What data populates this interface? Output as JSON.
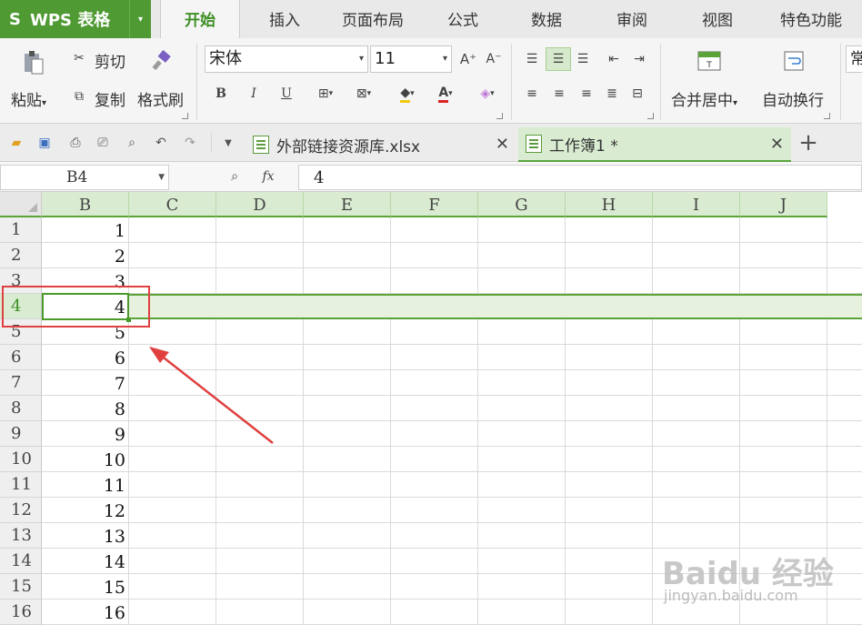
{
  "app": {
    "logo": "S",
    "name": "WPS 表格"
  },
  "menu": {
    "tabs": [
      {
        "label": "开始",
        "active": true
      },
      {
        "label": "插入"
      },
      {
        "label": "页面布局"
      },
      {
        "label": "公式"
      },
      {
        "label": "数据"
      },
      {
        "label": "审阅"
      },
      {
        "label": "视图"
      },
      {
        "label": "特色功能"
      }
    ]
  },
  "ribbon": {
    "paste": "粘贴",
    "cut": "剪切",
    "copy": "复制",
    "format_painter": "格式刷",
    "font_name": "宋体",
    "font_size": "11",
    "bold": "B",
    "italic": "I",
    "underline": "U",
    "grow_font": "A⁺",
    "shrink_font": "A⁻",
    "merge_center": "合并居中",
    "wrap_text": "自动换行",
    "number_format": "常"
  },
  "tabs": {
    "doc1": "外部链接资源库.xlsx",
    "doc2": "工作簿1 *",
    "add": "+"
  },
  "formula_bar": {
    "name_box": "B4",
    "fx": "fx",
    "value": "4"
  },
  "grid": {
    "columns": [
      "B",
      "C",
      "D",
      "E",
      "F",
      "G",
      "H",
      "I",
      "J"
    ],
    "rows": [
      "1",
      "2",
      "3",
      "4",
      "5",
      "6",
      "7",
      "8",
      "9",
      "10",
      "11",
      "12",
      "13",
      "14",
      "15",
      "16"
    ],
    "column_b_values": [
      "1",
      "2",
      "3",
      "4",
      "5",
      "6",
      "7",
      "8",
      "9",
      "10",
      "11",
      "12",
      "13",
      "14",
      "15",
      "16"
    ],
    "selected_cell": "B4"
  },
  "watermark": {
    "line1": "Baidu 经验",
    "line2": "jingyan.baidu.com"
  },
  "colors": {
    "accent": "#4f9a32",
    "selection": "#5aa43a",
    "annotation": "#e04040"
  }
}
